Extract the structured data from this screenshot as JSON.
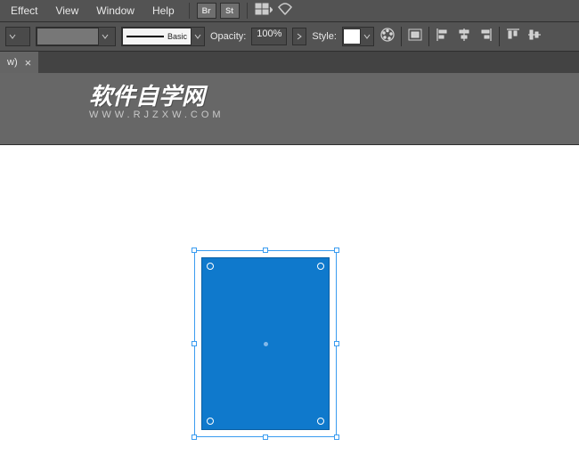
{
  "menu": {
    "effect": "Effect",
    "view": "View",
    "window": "Window",
    "help": "Help",
    "br_label": "Br",
    "st_label": "St"
  },
  "options": {
    "stroke_style_label": "Basic",
    "opacity_label": "Opacity:",
    "opacity_value": "100%",
    "style_label": "Style:"
  },
  "tab": {
    "title": "w)",
    "close": "×"
  },
  "watermark": {
    "chars": "软件自学网",
    "sub": "WWW.RJZXW.COM"
  },
  "shape": {
    "fill": "#0f79cc",
    "stroke": "#0b5fa3"
  }
}
